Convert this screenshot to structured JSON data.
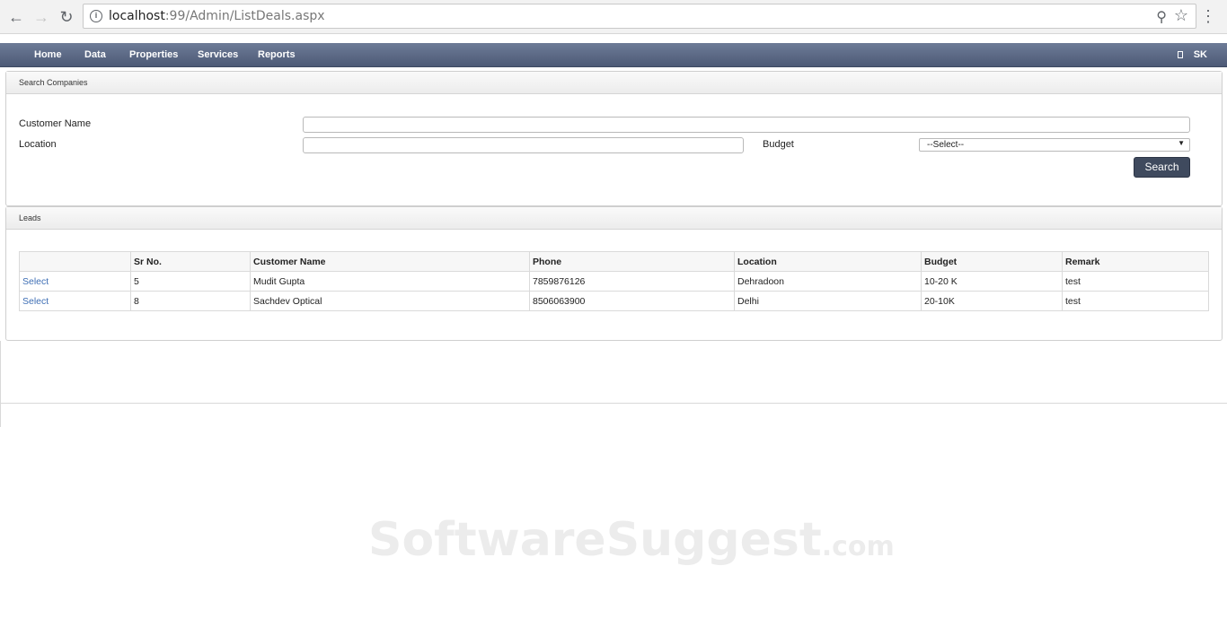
{
  "browser": {
    "url_host": "localhost",
    "url_rest": ":99/Admin/ListDeals.aspx"
  },
  "navbar": {
    "items": [
      "Home",
      "Data",
      "Properties",
      "Services",
      "Reports"
    ],
    "user": "SK"
  },
  "search_panel": {
    "title": "Search Companies",
    "customer_name_label": "Customer Name",
    "customer_name_value": "",
    "location_label": "Location",
    "location_value": "",
    "budget_label": "Budget",
    "budget_selected": "--Select--",
    "search_button": "Search"
  },
  "leads_panel": {
    "title": "Leads",
    "columns": [
      "",
      "Sr No.",
      "Customer Name",
      "Phone",
      "Location",
      "Budget",
      "Remark"
    ],
    "rows": [
      {
        "action": "Select",
        "sr": "5",
        "name": "Mudit Gupta",
        "phone": "7859876126",
        "location": "Dehradoon",
        "budget": "10-20 K",
        "remark": "test"
      },
      {
        "action": "Select",
        "sr": "8",
        "name": "Sachdev Optical",
        "phone": "8506063900",
        "location": "Delhi",
        "budget": "20-10K",
        "remark": "test"
      }
    ]
  },
  "watermark": {
    "main": "SoftwareSuggest",
    "suffix": ".com"
  }
}
